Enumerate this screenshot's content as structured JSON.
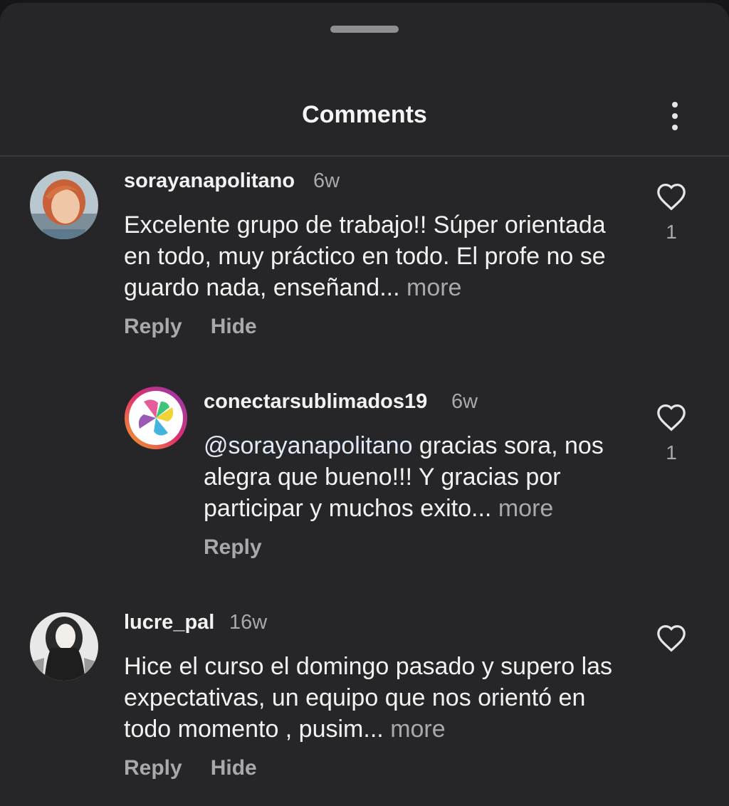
{
  "header": {
    "title": "Comments"
  },
  "comments": [
    {
      "username": "sorayanapolitano",
      "time": "6w",
      "text": "Excelente grupo de trabajo!! Súper orientada en todo, muy práctico en todo. El profe no se guardo nada, enseñand...",
      "more": "more",
      "reply_label": "Reply",
      "hide_label": "Hide",
      "likes": "1"
    },
    {
      "username": "conectarsublimados19",
      "time": "6w",
      "mention": "@sorayanapolitano",
      "text": " gracias sora, nos alegra que bueno!!! Y gracias por participar y muchos exito...",
      "more": "more",
      "reply_label": "Reply",
      "likes": "1"
    },
    {
      "username": "lucre_pal",
      "time": "16w",
      "text": "Hice el curso el domingo pasado y supero las expectativas,  un equipo que nos orientó en todo momento , pusim...",
      "more": "more",
      "reply_label": "Reply",
      "hide_label": "Hide"
    }
  ],
  "colors": {
    "background": "#262629",
    "muted": "#a8a8ad",
    "text": "#f2f2f2"
  },
  "icons": [
    "kebab-menu-icon",
    "heart-icon"
  ]
}
